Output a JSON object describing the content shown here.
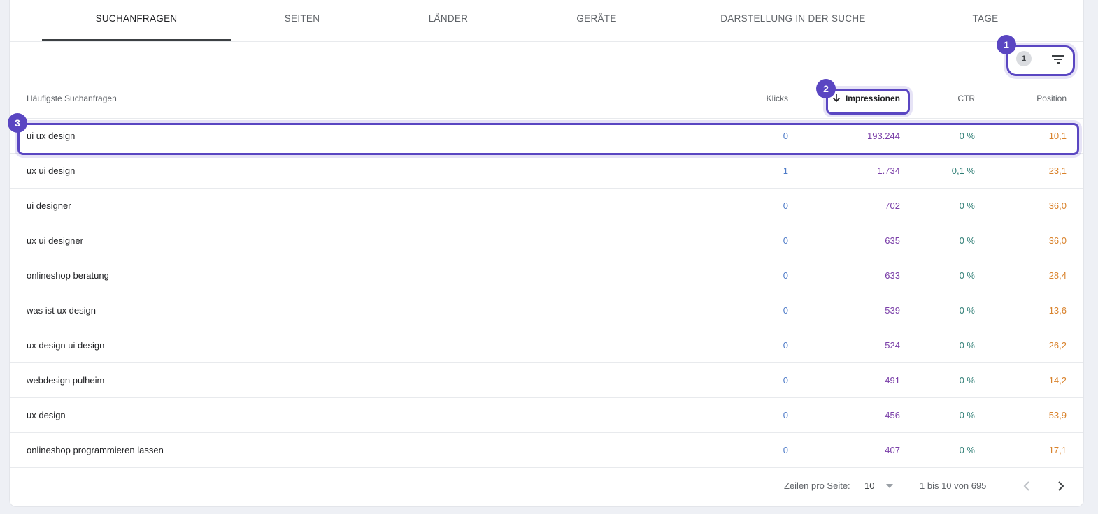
{
  "tabs": [
    {
      "label": "SUCHANFRAGEN"
    },
    {
      "label": "SEITEN"
    },
    {
      "label": "LÄNDER"
    },
    {
      "label": "GERÄTE"
    },
    {
      "label": "DARSTELLUNG IN DER SUCHE"
    },
    {
      "label": "TAGE"
    }
  ],
  "toolbar": {
    "filter_count": "1"
  },
  "table": {
    "headers": {
      "query": "Häufigste Suchanfragen",
      "clicks": "Klicks",
      "impressions": "Impressionen",
      "ctr": "CTR",
      "position": "Position"
    },
    "rows": [
      {
        "query": "ui ux design",
        "clicks": "0",
        "impressions": "193.244",
        "ctr": "0 %",
        "position": "10,1"
      },
      {
        "query": "ux ui design",
        "clicks": "1",
        "impressions": "1.734",
        "ctr": "0,1 %",
        "position": "23,1"
      },
      {
        "query": "ui designer",
        "clicks": "0",
        "impressions": "702",
        "ctr": "0 %",
        "position": "36,0"
      },
      {
        "query": "ux ui designer",
        "clicks": "0",
        "impressions": "635",
        "ctr": "0 %",
        "position": "36,0"
      },
      {
        "query": "onlineshop beratung",
        "clicks": "0",
        "impressions": "633",
        "ctr": "0 %",
        "position": "28,4"
      },
      {
        "query": "was ist ux design",
        "clicks": "0",
        "impressions": "539",
        "ctr": "0 %",
        "position": "13,6"
      },
      {
        "query": "ux design ui design",
        "clicks": "0",
        "impressions": "524",
        "ctr": "0 %",
        "position": "26,2"
      },
      {
        "query": "webdesign pulheim",
        "clicks": "0",
        "impressions": "491",
        "ctr": "0 %",
        "position": "14,2"
      },
      {
        "query": "ux design",
        "clicks": "0",
        "impressions": "456",
        "ctr": "0 %",
        "position": "53,9"
      },
      {
        "query": "onlineshop programmieren lassen",
        "clicks": "0",
        "impressions": "407",
        "ctr": "0 %",
        "position": "17,1"
      }
    ]
  },
  "footer": {
    "rows_per_page_label": "Zeilen pro Seite:",
    "rows_per_page_value": "10",
    "range": "1 bis 10 von 695"
  },
  "annotations": [
    {
      "label": "1"
    },
    {
      "label": "2"
    },
    {
      "label": "3"
    }
  ],
  "colors": {
    "accent": "#5a46c2",
    "clicks": "#4e7bc8",
    "impressions": "#7a3fa8",
    "ctr": "#2d7d74",
    "position": "#d9822b"
  },
  "icons": {
    "filter": "filter-icon",
    "sort": "arrow-down-icon",
    "dropdown": "chevron-down-icon",
    "prev": "chevron-left-icon",
    "next": "chevron-right-icon"
  }
}
